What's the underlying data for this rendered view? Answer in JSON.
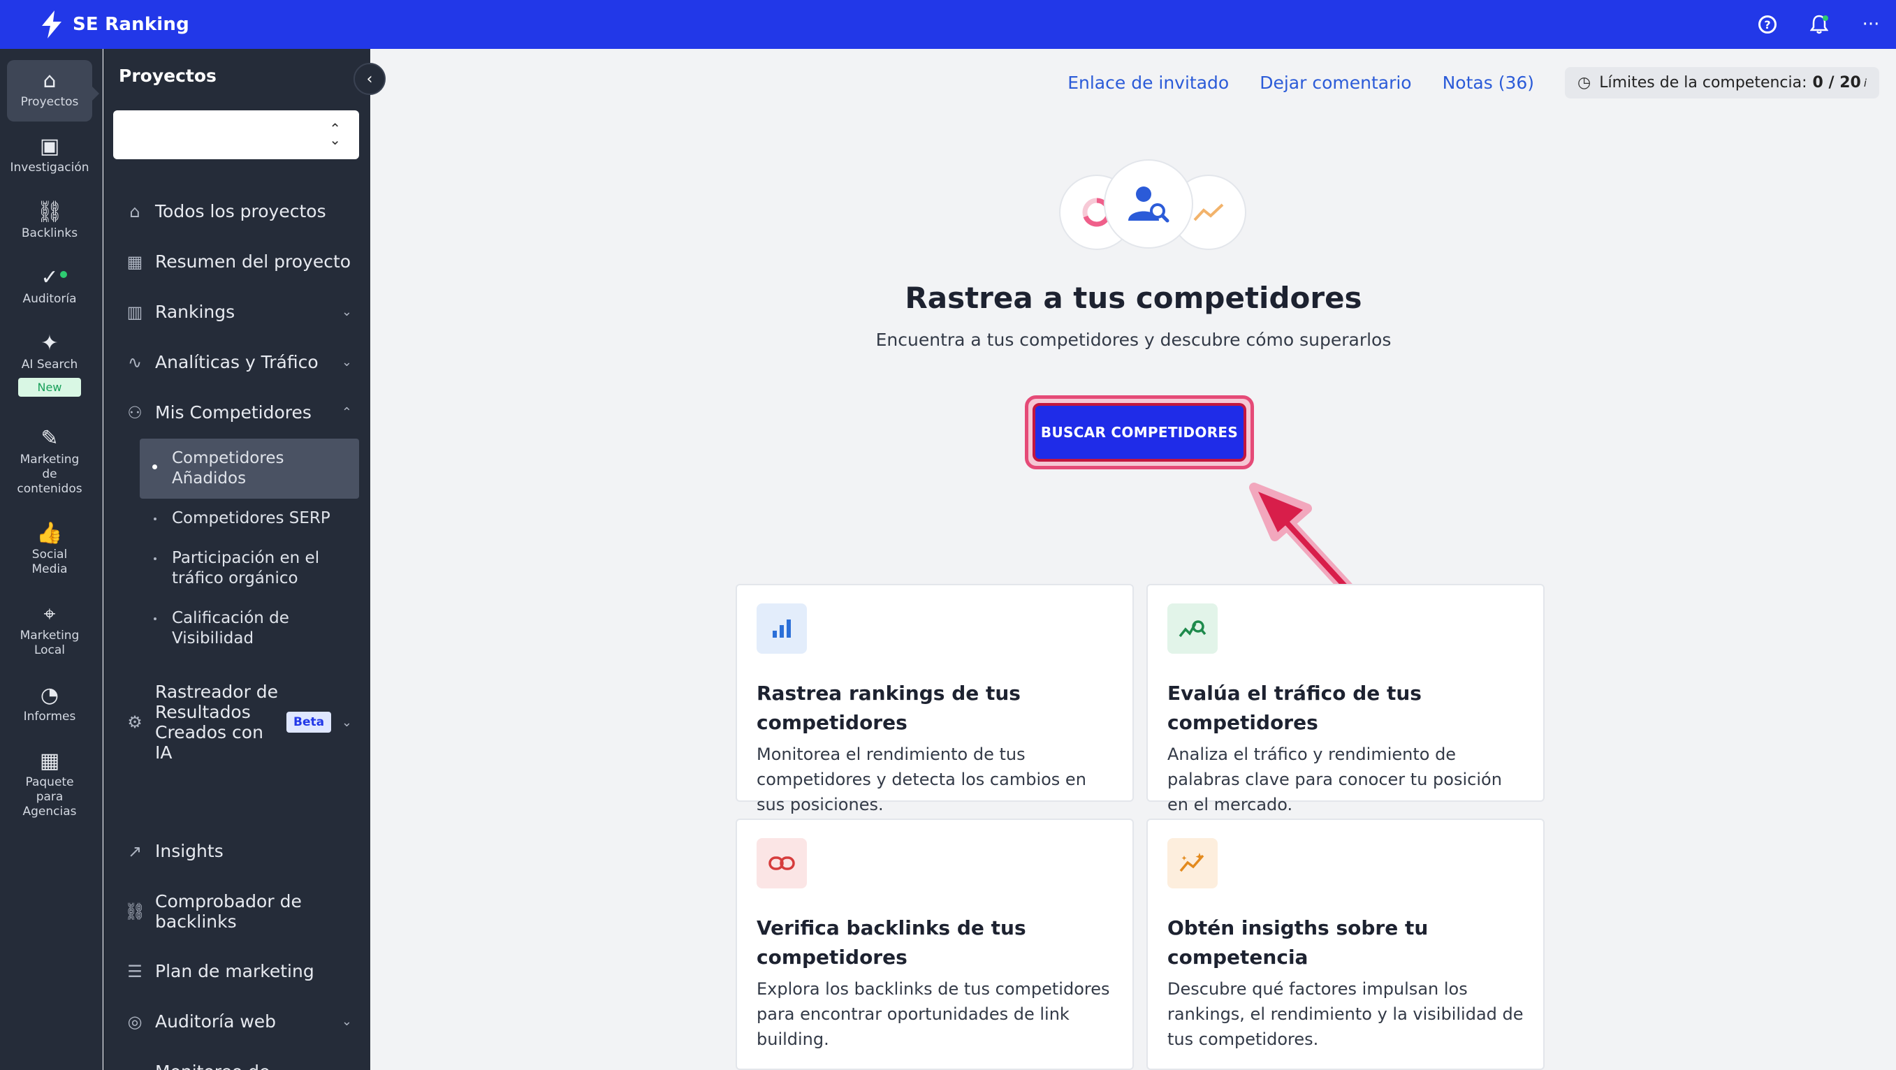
{
  "app": {
    "brand": "SE Ranking"
  },
  "rail": {
    "items": [
      {
        "label": "Proyectos",
        "icon": "home-icon"
      },
      {
        "label": "Investigación",
        "icon": "research-icon"
      },
      {
        "label": "Backlinks",
        "icon": "link-icon"
      },
      {
        "label": "Auditoría",
        "icon": "check-circle-icon"
      },
      {
        "label": "AI Search",
        "icon": "sparkle-icon",
        "badge": "New"
      },
      {
        "label": "Marketing de contenidos",
        "icon": "edit-icon"
      },
      {
        "label": "Social Media",
        "icon": "thumbs-up-icon"
      },
      {
        "label": "Marketing Local",
        "icon": "map-pin-icon"
      },
      {
        "label": "Informes",
        "icon": "pie-chart-icon"
      },
      {
        "label": "Paquete para Agencias",
        "icon": "building-icon"
      }
    ]
  },
  "sidebar": {
    "title": "Proyectos",
    "project_select": {
      "value": ""
    },
    "items": [
      {
        "label": "Todos los proyectos"
      },
      {
        "label": "Resumen del proyecto"
      },
      {
        "label": "Rankings"
      },
      {
        "label": "Analíticas y Tráfico"
      },
      {
        "label": "Mis Competidores"
      },
      {
        "label": "Rastreador de Resultados Creados con IA",
        "badge": "Beta"
      },
      {
        "label": "Insights"
      },
      {
        "label": "Comprobador de backlinks"
      },
      {
        "label": "Plan de marketing"
      },
      {
        "label": "Auditoría web"
      },
      {
        "label": "Monitoreo de Cambios en la Página"
      }
    ],
    "sub_items": [
      {
        "label": "Competidores Añadidos"
      },
      {
        "label": "Competidores SERP"
      },
      {
        "label": "Participación en el tráfico orgánico"
      },
      {
        "label": "Calificación de Visibilidad"
      }
    ]
  },
  "header": {
    "links": [
      "Enlace de invitado",
      "Dejar comentario",
      "Notas (36)"
    ],
    "limits": {
      "label": "Límites de la competencia:",
      "value": "0 / 20",
      "info": "i"
    }
  },
  "hero": {
    "title": "Rastrea a tus competidores",
    "subtitle": "Encuentra a tus competidores y descubre cómo superarlos",
    "cta": "BUSCAR COMPETIDORES"
  },
  "cards": [
    {
      "title": "Rastrea rankings de tus competidores",
      "desc": "Monitorea el rendimiento de tus competidores y detecta los cambios en sus posiciones.",
      "icon": "bar-chart-icon",
      "color": "#2b6fd8",
      "bg": "#e3edfb"
    },
    {
      "title": "Evalúa el tráfico de tus competidores",
      "desc": "Analiza el tráfico y rendimiento de palabras clave para conocer tu posición en el mercado.",
      "icon": "traffic-search-icon",
      "color": "#1e8a4c",
      "bg": "#e2f4e9"
    },
    {
      "title": "Verifica backlinks de tus competidores",
      "desc": "Explora los backlinks de tus competidores para encontrar oportunidades de link building.",
      "icon": "link-icon",
      "color": "#d63c3c",
      "bg": "#fbe5e5"
    },
    {
      "title": "Obtén insigths sobre tu competencia",
      "desc": "Descubre qué factores impulsan los rankings, el rendimiento y la visibilidad de tus competidores.",
      "icon": "insights-icon",
      "color": "#e38a1e",
      "bg": "#fdeedd"
    }
  ],
  "colors": {
    "topbar": "#2238e8",
    "sidebar": "#252c39",
    "accent": "#2b5bd8",
    "cta": "#1f2ce8",
    "highlight": "#e54a77"
  }
}
